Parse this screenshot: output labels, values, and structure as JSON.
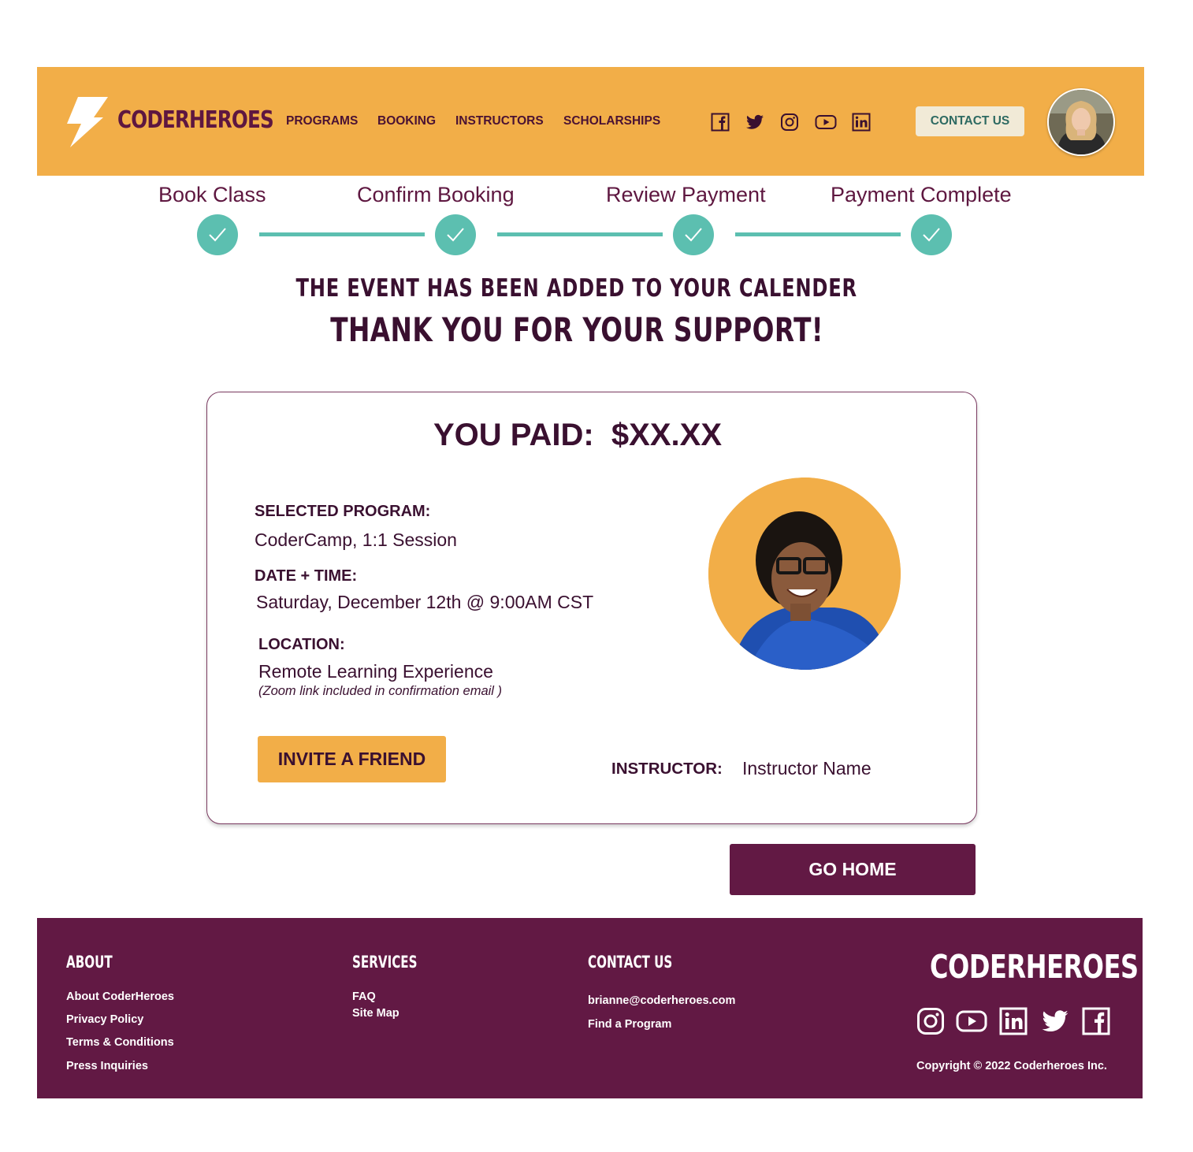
{
  "header": {
    "brand": "CODERHEROES",
    "nav": [
      "PROGRAMS",
      "BOOKING",
      "INSTRUCTORS",
      "SCHOLARSHIPS"
    ],
    "social_icons": [
      "facebook-icon",
      "twitter-icon",
      "instagram-icon",
      "youtube-icon",
      "linkedin-icon"
    ],
    "contact_label": "CONTACT US"
  },
  "stepper": {
    "steps": [
      "Book Class",
      "Confirm Booking",
      "Review Payment",
      "Payment Complete"
    ],
    "completed": 4
  },
  "headings": {
    "sub": "THE EVENT HAS BEEN ADDED TO YOUR CALENDER",
    "main": "THANK YOU FOR YOUR SUPPORT!"
  },
  "card": {
    "paid": "YOU PAID:  $XX.XX",
    "program_label": "SELECTED PROGRAM:",
    "program_value": "CoderCamp, 1:1 Session",
    "datetime_label": "DATE + TIME:",
    "datetime_value": "Saturday, December 12th @ 9:00AM CST",
    "location_label": "LOCATION:",
    "location_value": "Remote Learning Experience",
    "location_note": "(Zoom link included in confirmation email )",
    "invite_label": "INVITE A FRIEND",
    "instructor_label": "INSTRUCTOR:",
    "instructor_name": "Instructor Name"
  },
  "go_home_label": "GO HOME",
  "footer": {
    "about": {
      "heading": "ABOUT",
      "links": [
        "About CoderHeroes",
        "Privacy Policy",
        "Terms & Conditions",
        "Press Inquiries"
      ]
    },
    "services": {
      "heading": "SERVICES",
      "links": [
        "FAQ",
        "Site Map"
      ]
    },
    "contact": {
      "heading": "CONTACT US",
      "links": [
        "brianne@coderheroes.com",
        "Find a Program"
      ]
    },
    "brand": "CODERHEROES",
    "social_icons": [
      "instagram-icon",
      "youtube-icon",
      "linkedin-icon",
      "twitter-icon",
      "facebook-icon"
    ],
    "copyright": "Copyright © 2022 Coderheroes Inc."
  },
  "colors": {
    "header_bg": "#f2ae48",
    "brand_purple": "#621944",
    "text_dark": "#3a1030",
    "step_teal": "#5cbfb0",
    "contact_btn_bg": "#f1ead7",
    "contact_btn_text": "#2e6a62"
  }
}
